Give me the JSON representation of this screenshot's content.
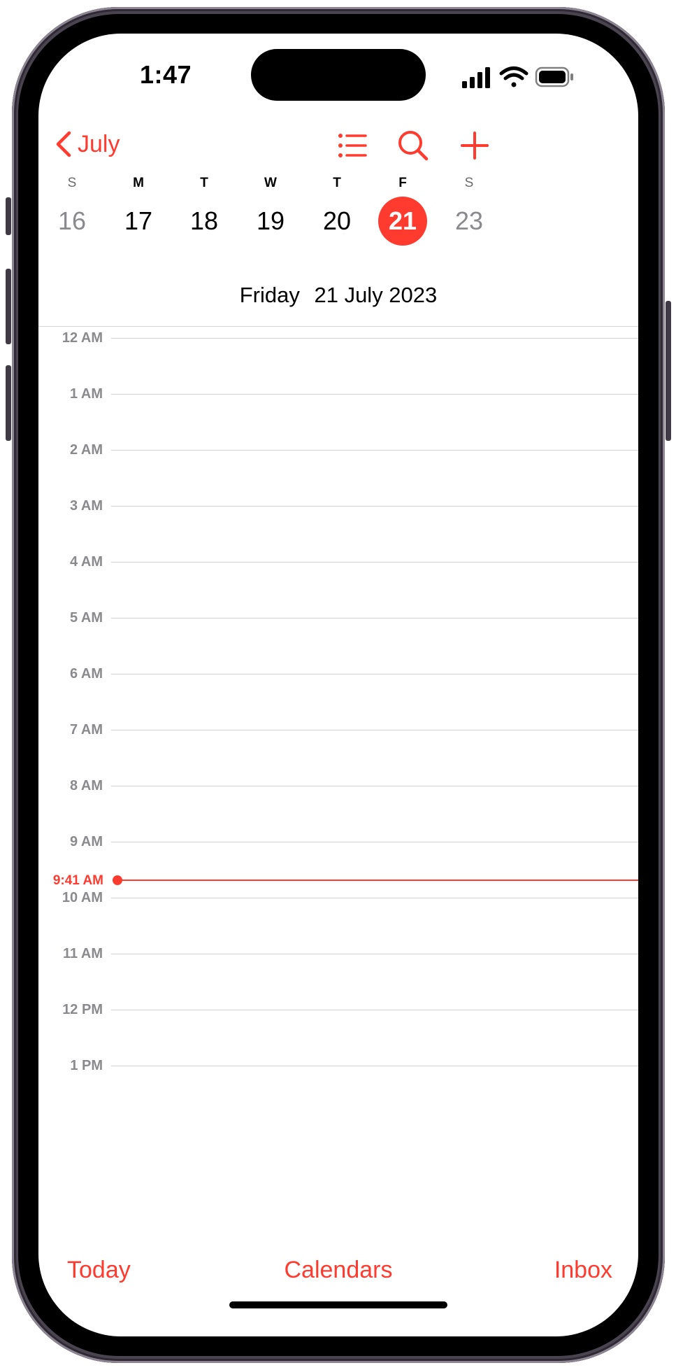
{
  "status_bar": {
    "time": "1:47",
    "icons": [
      "cellular-signal-icon",
      "wifi-icon",
      "battery-icon"
    ]
  },
  "nav": {
    "back_label": "July",
    "icons": [
      "chevron-left-icon",
      "list-icon",
      "search-icon",
      "plus-icon"
    ]
  },
  "week": {
    "days": [
      {
        "letter": "S",
        "number": "16"
      },
      {
        "letter": "M",
        "number": "17"
      },
      {
        "letter": "T",
        "number": "18"
      },
      {
        "letter": "W",
        "number": "19"
      },
      {
        "letter": "T",
        "number": "20"
      },
      {
        "letter": "F",
        "number": "21"
      },
      {
        "letter": "S",
        "number": "23"
      }
    ],
    "selected_index": 5
  },
  "selected_date": {
    "weekday": "Friday",
    "date": "21 July 2023"
  },
  "timeline": {
    "hours": [
      "12 AM",
      "1 AM",
      "2 AM",
      "3 AM",
      "4 AM",
      "5 AM",
      "6 AM",
      "7 AM",
      "8 AM",
      "9 AM",
      "10 AM",
      "11 AM",
      "12 PM",
      "1 PM"
    ],
    "current_time": "9:41 AM"
  },
  "tab_bar": {
    "today": "Today",
    "calendars": "Calendars",
    "inbox": "Inbox"
  },
  "colors": {
    "accent": "#ff3b30",
    "muted_text": "#8a8a8e",
    "grid_line": "#d1d1d6"
  }
}
